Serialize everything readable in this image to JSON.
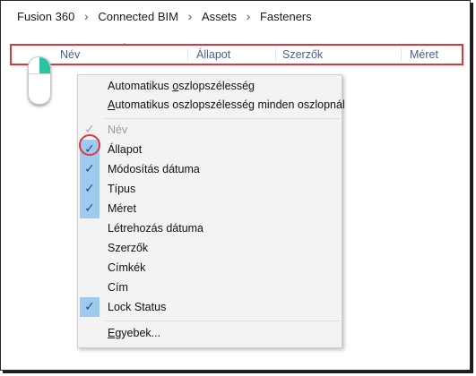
{
  "breadcrumb": {
    "items": [
      "Fusion 360",
      "Connected BIM",
      "Assets",
      "Fasteners"
    ],
    "separator": ">"
  },
  "columns": {
    "sort_indicator": "^",
    "headers": [
      "Név",
      "Állapot",
      "Szerzők",
      "Méret"
    ]
  },
  "menu": {
    "top_items": [
      {
        "label_prefix": "Automatikus ",
        "label_underlined": "o",
        "label_suffix": "szlopszélesség"
      },
      {
        "label_prefix": "",
        "label_underlined": "A",
        "label_suffix": "utomatikus oszlopszélesség minden oszlopnál"
      }
    ],
    "column_items": [
      {
        "label": "Név",
        "checked": true,
        "disabled": true
      },
      {
        "label": "Állapot",
        "checked": true,
        "disabled": false,
        "highlighted": true
      },
      {
        "label": "Módosítás dátuma",
        "checked": true,
        "disabled": false
      },
      {
        "label": "Típus",
        "checked": true,
        "disabled": false
      },
      {
        "label": "Méret",
        "checked": true,
        "disabled": false
      },
      {
        "label": "Létrehozás dátuma",
        "checked": false,
        "disabled": false
      },
      {
        "label": "Szerzők",
        "checked": false,
        "disabled": false
      },
      {
        "label": "Címkék",
        "checked": false,
        "disabled": false
      },
      {
        "label": "Cím",
        "checked": false,
        "disabled": false
      },
      {
        "label": "Lock Status",
        "checked": true,
        "disabled": false
      }
    ],
    "more_item": {
      "label_prefix": "",
      "label_underlined": "E",
      "label_suffix": "gyebek..."
    }
  },
  "icons": {
    "check": "checkmark-icon",
    "mouse": "mouse-right-click-icon",
    "chevron": "chevron-right-icon"
  },
  "colors": {
    "annotation_red": "#e0353f",
    "check_highlight": "#9fcaf0",
    "mouse_button": "#2cc3a4",
    "header_text": "#4a5f86"
  }
}
